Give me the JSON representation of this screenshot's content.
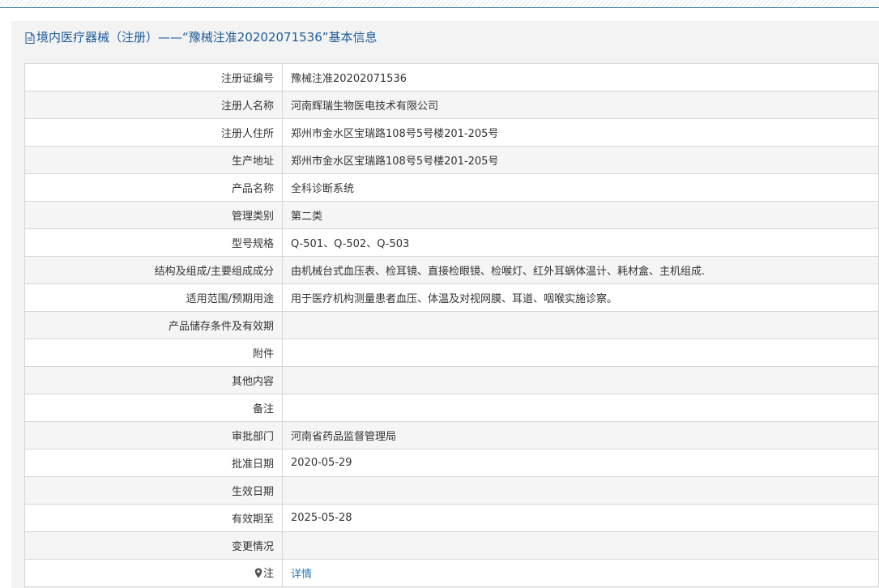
{
  "panel": {
    "title": "境内医疗器械（注册）——“豫械注准20202071536”基本信息"
  },
  "rows": [
    {
      "label": "注册证编号",
      "value": "豫械注准20202071536"
    },
    {
      "label": "注册人名称",
      "value": "河南辉瑞生物医电技术有限公司"
    },
    {
      "label": "注册人住所",
      "value": "郑州市金水区宝瑞路108号5号楼201-205号"
    },
    {
      "label": "生产地址",
      "value": "郑州市金水区宝瑞路108号5号楼201-205号"
    },
    {
      "label": "产品名称",
      "value": "全科诊断系统"
    },
    {
      "label": "管理类别",
      "value": "第二类"
    },
    {
      "label": "型号规格",
      "value": "Q-501、Q-502、Q-503"
    },
    {
      "label": "结构及组成/主要组成成分",
      "value": "由机械台式血压表、检耳镜、直接检眼镜、检喉灯、红外耳蜗体温计、耗材盒、主机组成."
    },
    {
      "label": "适用范围/预期用途",
      "value": "用于医疗机构测量患者血压、体温及对视网膜、耳道、咽喉实施诊察。"
    },
    {
      "label": "产品储存条件及有效期",
      "value": ""
    },
    {
      "label": "附件",
      "value": ""
    },
    {
      "label": "其他内容",
      "value": ""
    },
    {
      "label": "备注",
      "value": ""
    },
    {
      "label": "审批部门",
      "value": "河南省药品监督管理局"
    },
    {
      "label": "批准日期",
      "value": "2020-05-29"
    },
    {
      "label": "生效日期",
      "value": ""
    },
    {
      "label": "有效期至",
      "value": "2025-05-28"
    },
    {
      "label": "变更情况",
      "value": ""
    }
  ],
  "note": {
    "label": "注",
    "icon": "map-pin-icon",
    "link": "详情"
  }
}
